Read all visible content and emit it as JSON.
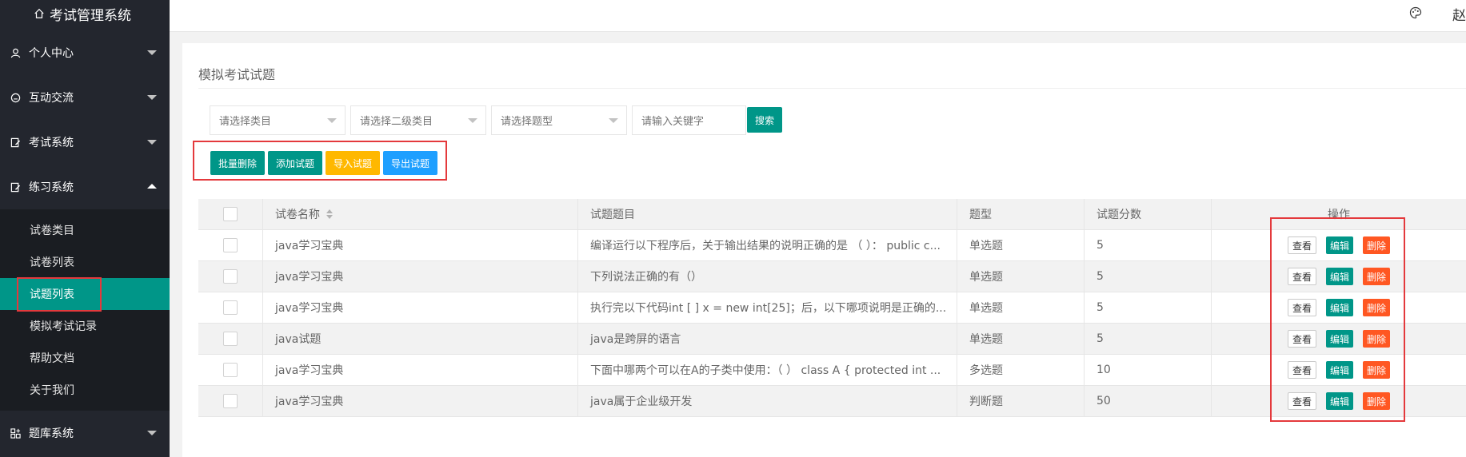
{
  "app": {
    "title": "考试管理系统",
    "user": "赵"
  },
  "sidebar": {
    "groups": [
      {
        "label": "个人中心",
        "icon": "user-icon"
      },
      {
        "label": "互动交流",
        "icon": "chat-icon"
      },
      {
        "label": "考试系统",
        "icon": "exam-icon"
      },
      {
        "label": "练习系统",
        "icon": "practice-icon",
        "expanded": true
      }
    ],
    "submenu": [
      {
        "label": "试卷类目"
      },
      {
        "label": "试卷列表"
      },
      {
        "label": "试题列表",
        "active": true
      },
      {
        "label": "模拟考试记录"
      },
      {
        "label": "帮助文档"
      },
      {
        "label": "关于我们"
      }
    ],
    "last_group": {
      "label": "题库系统",
      "icon": "question-bank-icon"
    }
  },
  "page": {
    "title": "模拟考试试题"
  },
  "filters": {
    "category_placeholder": "请选择类目",
    "subcategory_placeholder": "请选择二级类目",
    "type_placeholder": "请选择题型",
    "keyword_placeholder": "请输入关键字",
    "search_label": "搜索"
  },
  "toolbar": {
    "batch_delete": "批量删除",
    "add": "添加试题",
    "import": "导入试题",
    "export": "导出试题"
  },
  "table": {
    "headers": [
      "试卷名称",
      "试题题目",
      "题型",
      "试题分数",
      "操作"
    ],
    "rows": [
      {
        "paper": "java学习宝典",
        "question": "编译运行以下程序后，关于输出结果的说明正确的是 （ ）： public c...",
        "type": "单选题",
        "score": "5"
      },
      {
        "paper": "java学习宝典",
        "question": "下列说法正确的有（）",
        "type": "单选题",
        "score": "5"
      },
      {
        "paper": "java学习宝典",
        "question": "执行完以下代码int [ ] x = new int[25]；后，以下哪项说明是正确的...",
        "type": "单选题",
        "score": "5"
      },
      {
        "paper": "java试题",
        "question": "java是跨屏的语言",
        "type": "单选题",
        "score": "5"
      },
      {
        "paper": "java学习宝典",
        "question": "下面中哪两个可以在A的子类中使用：（ ） class A { protected int ...",
        "type": "多选题",
        "score": "10"
      },
      {
        "paper": "java学习宝典",
        "question": "java属于企业级开发",
        "type": "判断题",
        "score": "50"
      }
    ],
    "actions": {
      "view": "查看",
      "edit": "编辑",
      "delete": "删除"
    }
  },
  "colors": {
    "sidebar_bg": "#23262e",
    "accent": "#009688",
    "warning": "#ffb800",
    "info": "#1e9fff",
    "danger": "#ff5722",
    "highlight_box": "#e4393c"
  }
}
